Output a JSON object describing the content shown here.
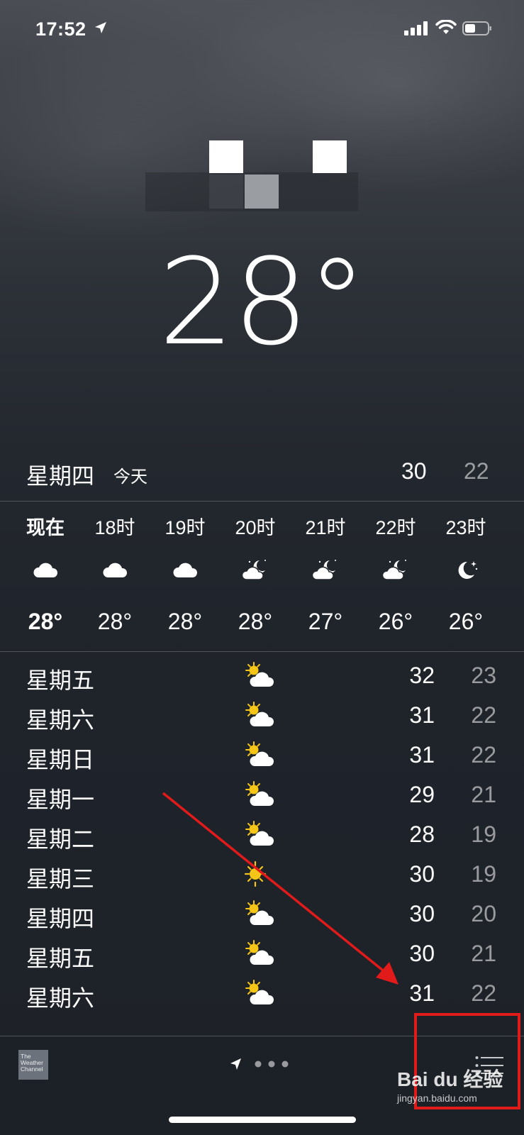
{
  "status_bar": {
    "time": "17:52",
    "icons": [
      "location-arrow-icon",
      "cellular-signal-icon",
      "wifi-icon",
      "battery-icon"
    ]
  },
  "location": {
    "name_obscured": true
  },
  "current": {
    "temp": "28°"
  },
  "today": {
    "day": "星期四",
    "label": "今天",
    "high": "30",
    "low": "22"
  },
  "hourly": [
    {
      "time": "现在",
      "icon": "cloud-icon",
      "temp": "28°",
      "bold": true
    },
    {
      "time": "18时",
      "icon": "cloud-icon",
      "temp": "28°"
    },
    {
      "time": "19时",
      "icon": "cloud-icon",
      "temp": "28°"
    },
    {
      "time": "20时",
      "icon": "partly-cloudy-night-icon",
      "temp": "28°"
    },
    {
      "time": "21时",
      "icon": "partly-cloudy-night-icon",
      "temp": "27°"
    },
    {
      "time": "22时",
      "icon": "partly-cloudy-night-icon",
      "temp": "26°"
    },
    {
      "time": "23时",
      "icon": "moon-stars-icon",
      "temp": "26°"
    }
  ],
  "daily": [
    {
      "day": "星期五",
      "icon": "partly-sunny-icon",
      "high": "32",
      "low": "23"
    },
    {
      "day": "星期六",
      "icon": "partly-sunny-icon",
      "high": "31",
      "low": "22"
    },
    {
      "day": "星期日",
      "icon": "partly-sunny-icon",
      "high": "31",
      "low": "22"
    },
    {
      "day": "星期一",
      "icon": "partly-sunny-icon",
      "high": "29",
      "low": "21"
    },
    {
      "day": "星期二",
      "icon": "partly-sunny-icon",
      "high": "28",
      "low": "19"
    },
    {
      "day": "星期三",
      "icon": "sun-icon",
      "high": "30",
      "low": "19"
    },
    {
      "day": "星期四",
      "icon": "partly-sunny-icon",
      "high": "30",
      "low": "20"
    },
    {
      "day": "星期五",
      "icon": "partly-sunny-icon",
      "high": "30",
      "low": "21"
    },
    {
      "day": "星期六",
      "icon": "partly-sunny-icon",
      "high": "31",
      "low": "22"
    }
  ],
  "bottom_bar": {
    "logo_text": "The Weather Channel",
    "page_dots": 3,
    "list_icon": "list-icon"
  },
  "watermark": {
    "text": "Bai du 经验",
    "sub": "jingyan.baidu.com"
  },
  "colors": {
    "annotation": "#e11a1a",
    "background": "#1e2229",
    "sun": "#f5c518"
  }
}
